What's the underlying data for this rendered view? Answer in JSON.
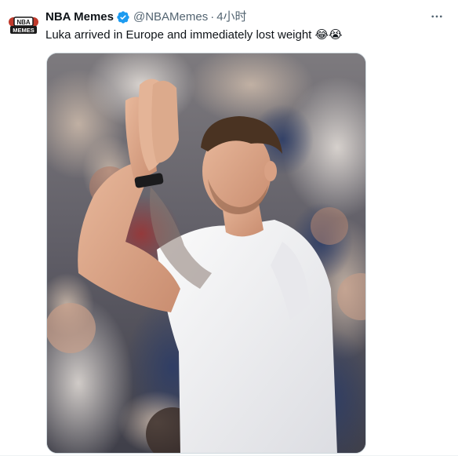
{
  "tweet": {
    "display_name": "NBA Memes",
    "handle": "@NBAMemes",
    "separator": "·",
    "time": "4小时",
    "text": "Luka arrived in Europe and immediately lost weight",
    "emoji": "😂😭",
    "avatar_logo_top": "NBA",
    "avatar_logo_bottom": "MEMES"
  },
  "icons": {
    "verified": "verified-badge-icon",
    "more": "more-options-icon"
  },
  "colors": {
    "verified_blue": "#1d9bf0",
    "secondary_text": "#536471",
    "primary_text": "#0f1419"
  }
}
